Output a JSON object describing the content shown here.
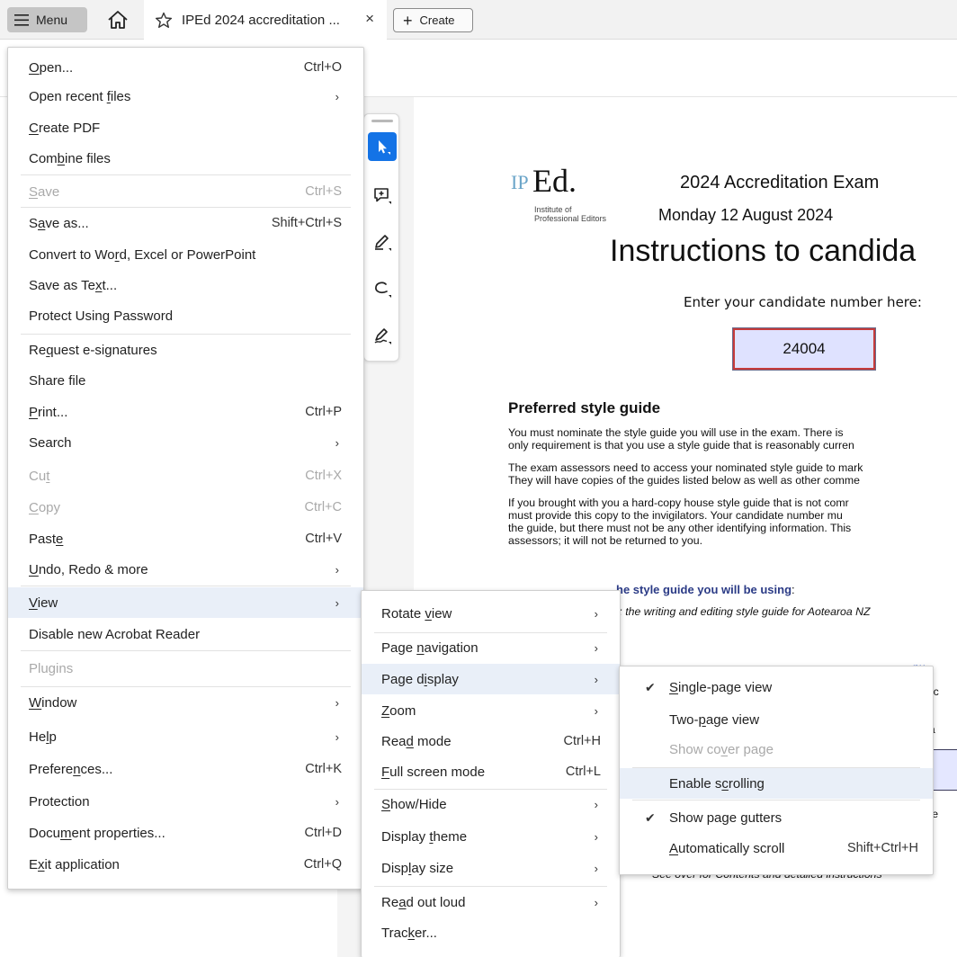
{
  "tabbar": {
    "menu_label": "Menu",
    "tab_title": "IPEd 2024 accreditation ...",
    "tab_close": "×",
    "create_plus": "+",
    "create_label": "Create"
  },
  "document": {
    "logo_ip": "IP",
    "logo_ed": "Ed.",
    "logo_line1": "Institute of",
    "logo_line2": "Professional Editors",
    "exam_title": "2024 Accreditation Exam",
    "exam_date": "Monday 12 August 2024",
    "instructions_title": "Instructions to candida",
    "candidate_label": "Enter your candidate number here:",
    "candidate_number": "24004",
    "style_heading": "Preferred style guide",
    "p1_l1": "You must nominate the style guide you will use in the exam. There is",
    "p1_l2": "only requirement is that you use a style guide that is reasonably curren",
    "p2_l1": "The exam assessors need to access your nominated style guide to mark",
    "p2_l2": "They will have copies of the guides listed below as well as other comme",
    "p3_l1": "If you brought with you a hard-copy house style guide that is not comr",
    "p3_l2": "must provide this copy to the invigilators. Your candidate number mu",
    "p3_l3": "the guide, but there must not be any other identifying information. This",
    "p3_l4": "assessors; it will not be returned to you.",
    "blue_heading": "he style guide you will be using",
    "blue_colon": ":",
    "italic_line": "t: the writing and editing style guide for Aotearoa NZ",
    "frag_link": "nu",
    "frag_paren": ") (c",
    "frag_fa": "f a",
    "frag_ate": "ate",
    "see_over": "See over for Contents and detailed instructions"
  },
  "main_menu": {
    "items": [
      {
        "pre": "",
        "u": "O",
        "post": "pen...",
        "shortcut": "Ctrl+O"
      },
      {
        "pre": "Open recent ",
        "u": "f",
        "post": "iles",
        "arrow": "›"
      },
      {
        "pre": "",
        "u": "C",
        "post": "reate PDF"
      },
      {
        "pre": "Com",
        "u": "b",
        "post": "ine files"
      },
      {
        "pre": "",
        "u": "S",
        "post": "ave",
        "shortcut": "Ctrl+S"
      },
      {
        "pre": "S",
        "u": "a",
        "post": "ve as...",
        "shortcut": "Shift+Ctrl+S"
      },
      {
        "pre": "Convert to Wo",
        "u": "r",
        "post": "d, Excel or PowerPoint"
      },
      {
        "pre": "Save as Te",
        "u": "x",
        "post": "t..."
      },
      {
        "pre": "Protect Using Password",
        "u": "",
        "post": ""
      },
      {
        "pre": "Re",
        "u": "q",
        "post": "uest e-signatures"
      },
      {
        "pre": "Share file",
        "u": "",
        "post": ""
      },
      {
        "pre": "",
        "u": "P",
        "post": "rint...",
        "shortcut": "Ctrl+P"
      },
      {
        "pre": "Search",
        "u": "",
        "post": "",
        "arrow": "›"
      },
      {
        "pre": "Cu",
        "u": "t",
        "post": "",
        "shortcut": "Ctrl+X"
      },
      {
        "pre": "",
        "u": "C",
        "post": "opy",
        "shortcut": "Ctrl+C"
      },
      {
        "pre": "Past",
        "u": "e",
        "post": "",
        "shortcut": "Ctrl+V"
      },
      {
        "pre": "",
        "u": "U",
        "post": "ndo, Redo & more",
        "arrow": "›"
      },
      {
        "pre": "",
        "u": "V",
        "post": "iew",
        "arrow": "›"
      },
      {
        "pre": "Disable new Acrobat Reader",
        "u": "",
        "post": ""
      },
      {
        "pre": "Plugins",
        "u": "",
        "post": ""
      },
      {
        "pre": "",
        "u": "W",
        "post": "indow",
        "arrow": "›"
      },
      {
        "pre": "He",
        "u": "l",
        "post": "p",
        "arrow": "›"
      },
      {
        "pre": "Prefere",
        "u": "n",
        "post": "ces...",
        "shortcut": "Ctrl+K"
      },
      {
        "pre": "Protection",
        "u": "",
        "post": "",
        "arrow": "›"
      },
      {
        "pre": "Docu",
        "u": "m",
        "post": "ent properties...",
        "shortcut": "Ctrl+D"
      },
      {
        "pre": "E",
        "u": "x",
        "post": "it application",
        "shortcut": "Ctrl+Q"
      }
    ]
  },
  "view_menu": {
    "items": [
      {
        "pre": "Rotate ",
        "u": "v",
        "post": "iew",
        "arrow": "›"
      },
      {
        "pre": "Page ",
        "u": "n",
        "post": "avigation",
        "arrow": "›"
      },
      {
        "pre": "Page d",
        "u": "i",
        "post": "splay",
        "arrow": "›"
      },
      {
        "pre": "",
        "u": "Z",
        "post": "oom",
        "arrow": "›"
      },
      {
        "pre": "Rea",
        "u": "d",
        "post": " mode",
        "shortcut": "Ctrl+H"
      },
      {
        "pre": "",
        "u": "F",
        "post": "ull screen mode",
        "shortcut": "Ctrl+L"
      },
      {
        "pre": "",
        "u": "S",
        "post": "how/Hide",
        "arrow": "›"
      },
      {
        "pre": "Display ",
        "u": "t",
        "post": "heme",
        "arrow": "›"
      },
      {
        "pre": "Disp",
        "u": "l",
        "post": "ay size",
        "arrow": "›"
      },
      {
        "pre": "Re",
        "u": "a",
        "post": "d out loud",
        "arrow": "›"
      },
      {
        "pre": "Trac",
        "u": "k",
        "post": "er..."
      }
    ]
  },
  "page_display_menu": {
    "items": [
      {
        "check": "✔",
        "pre": "",
        "u": "S",
        "post": "ingle-page view"
      },
      {
        "check": "",
        "pre": "Two-",
        "u": "p",
        "post": "age view"
      },
      {
        "check": "",
        "pre": "Show co",
        "u": "v",
        "post": "er page"
      },
      {
        "check": "",
        "pre": "Enable s",
        "u": "c",
        "post": "rolling"
      },
      {
        "check": "✔",
        "pre": "Show page gutters",
        "u": "",
        "post": ""
      },
      {
        "check": "",
        "pre": "",
        "u": "A",
        "post": "utomatically scroll",
        "shortcut": "Shift+Ctrl+H"
      }
    ]
  }
}
